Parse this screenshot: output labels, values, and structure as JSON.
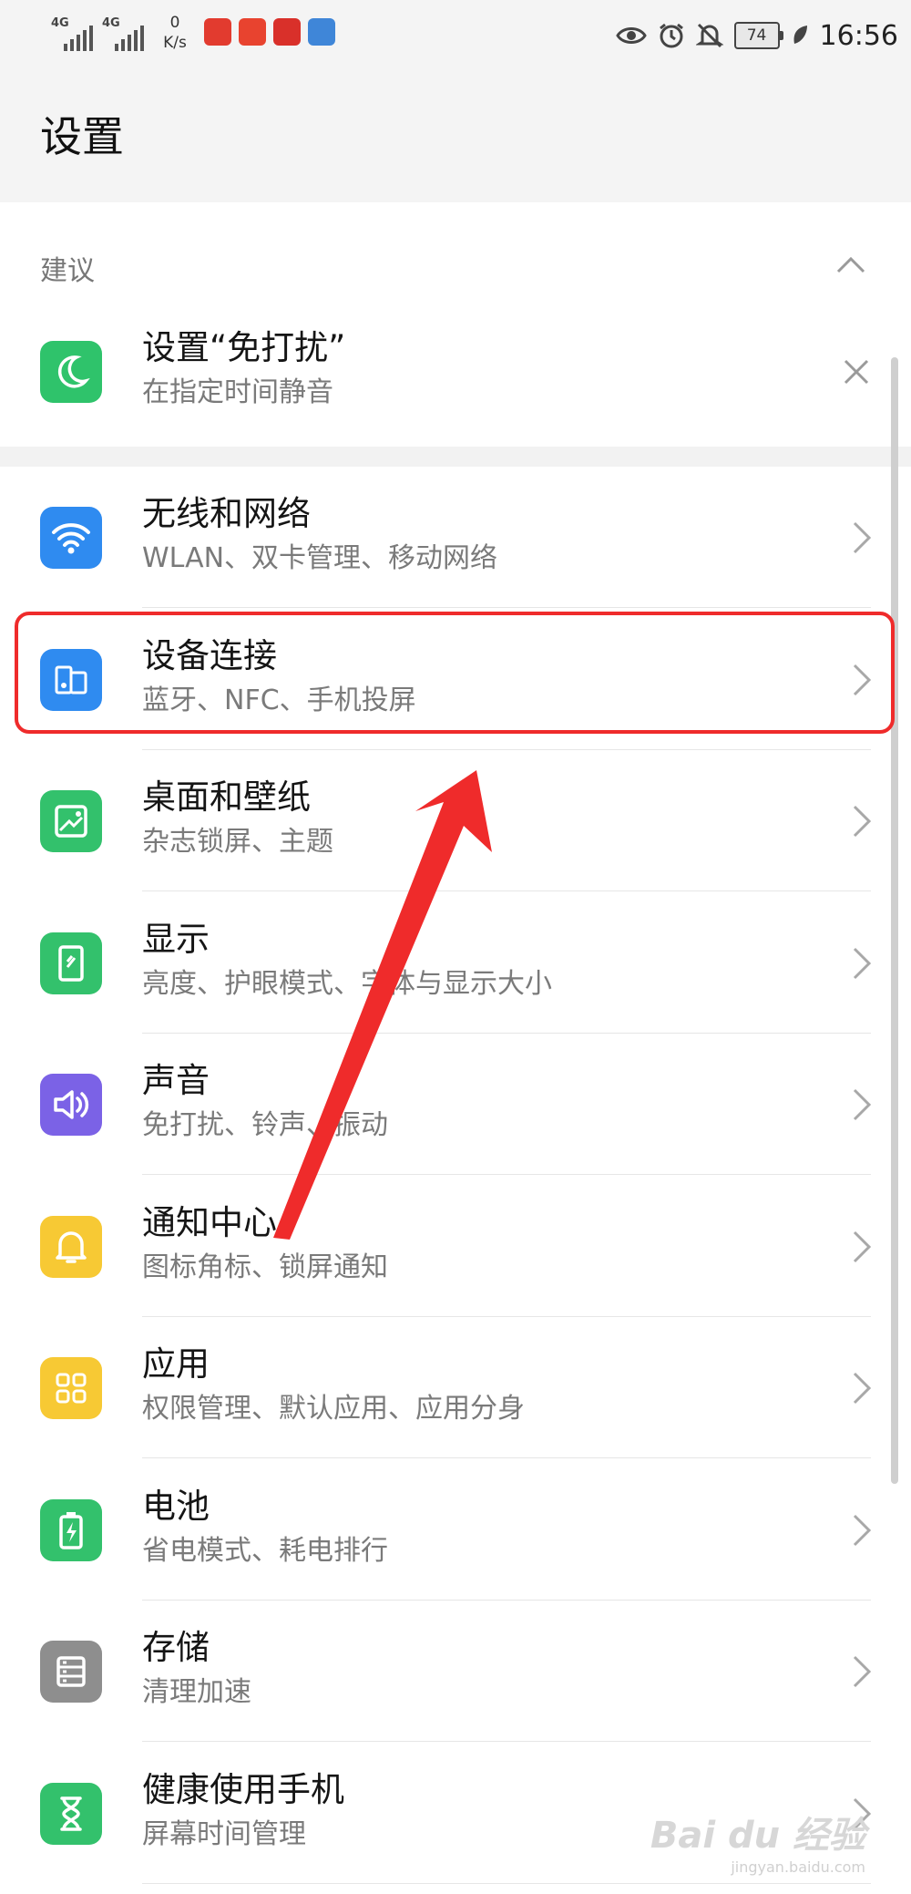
{
  "status_bar": {
    "sim1_tag": "4G",
    "sim2_tag": "4G",
    "net_speed_value": "0",
    "net_speed_unit": "K/s",
    "battery_level": "74",
    "time": "16:56"
  },
  "header": {
    "title": "设置"
  },
  "suggestions": {
    "section_label": "建议",
    "item": {
      "title": "设置“免打扰”",
      "subtitle": "在指定时间静音",
      "icon": "moon-icon",
      "color": "#2fc36b"
    }
  },
  "settings": [
    {
      "id": "wireless",
      "title": "无线和网络",
      "subtitle": "WLAN、双卡管理、移动网络",
      "icon": "wifi-icon",
      "color": "#2f8bf0"
    },
    {
      "id": "device-connection",
      "title": "设备连接",
      "subtitle": "蓝牙、NFC、手机投屏",
      "icon": "device-connection-icon",
      "color": "#2f8bf0"
    },
    {
      "id": "home-wallpaper",
      "title": "桌面和壁纸",
      "subtitle": "杂志锁屏、主题",
      "icon": "wallpaper-icon",
      "color": "#33c16c"
    },
    {
      "id": "display",
      "title": "显示",
      "subtitle": "亮度、护眼模式、字体与显示大小",
      "icon": "display-icon",
      "color": "#33c16c"
    },
    {
      "id": "sound",
      "title": "声音",
      "subtitle": "免打扰、铃声、振动",
      "icon": "speaker-icon",
      "color": "#7b62e6"
    },
    {
      "id": "notifications",
      "title": "通知中心",
      "subtitle": "图标角标、锁屏通知",
      "icon": "bell-icon",
      "color": "#f7c934"
    },
    {
      "id": "apps",
      "title": "应用",
      "subtitle": "权限管理、默认应用、应用分身",
      "icon": "apps-grid-icon",
      "color": "#f7c934"
    },
    {
      "id": "battery",
      "title": "电池",
      "subtitle": "省电模式、耗电排行",
      "icon": "battery-icon",
      "color": "#33c16c"
    },
    {
      "id": "storage",
      "title": "存储",
      "subtitle": "清理加速",
      "icon": "storage-icon",
      "color": "#8e8e8e"
    },
    {
      "id": "digital-balance",
      "title": "健康使用手机",
      "subtitle": "屏幕时间管理",
      "icon": "hourglass-icon",
      "color": "#33c16c"
    }
  ],
  "annotation": {
    "highlight_color": "#ef2b2b",
    "highlighted_item": "device-connection"
  },
  "watermark": {
    "text": "Bai du 经验",
    "sub": "jingyan.baidu.com"
  }
}
